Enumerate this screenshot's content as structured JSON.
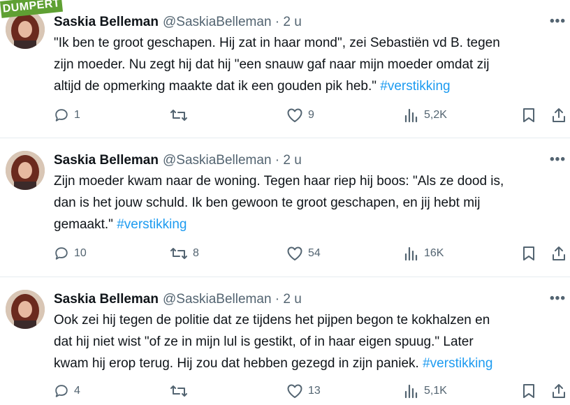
{
  "badge": "DUMPERT",
  "tweets": [
    {
      "name": "Saskia Belleman",
      "handle": "@SaskiaBelleman · 2 u",
      "line1": "\"Ik ben te groot geschapen. Hij zat in haar mond\", zei  Sebastiën vd B. tegen",
      "line2": "zijn moeder. Nu zegt hij dat hij \"een snauw gaf naar mijn moeder omdat zij",
      "line3": "altijd de opmerking maakte dat ik een gouden pik heb.\"",
      "hashtag": "#verstikking",
      "replies": "1",
      "retweets": "",
      "likes": "9",
      "views": "5,2K"
    },
    {
      "name": "Saskia Belleman",
      "handle": "@SaskiaBelleman · 2 u",
      "line1": "Zijn moeder kwam naar de woning. Tegen haar riep hij boos: \"Als ze dood is,",
      "line2": "dan is het jouw schuld. Ik ben gewoon te groot geschapen, en jij hebt mij",
      "line3": "gemaakt.\"",
      "hashtag": "#verstikking",
      "replies": "10",
      "retweets": "8",
      "likes": "54",
      "views": "16K"
    },
    {
      "name": "Saskia Belleman",
      "handle": "@SaskiaBelleman · 2 u",
      "line1": "Ook zei hij tegen de politie dat ze tijdens het pijpen begon te kokhalzen en",
      "line2": "dat hij niet wist \"of ze in mijn lul is gestikt, of in haar eigen spuug.\" Later",
      "line3": "kwam hij erop terug. Hij zou dat hebben gezegd in zijn paniek.",
      "hashtag": "#verstikking",
      "replies": "4",
      "retweets": "",
      "likes": "13",
      "views": "5,1K"
    }
  ],
  "colors": {
    "hashtag": "#1d9bf0",
    "muted": "#536471",
    "badge": "#5fa033"
  },
  "icons": [
    "reply-icon",
    "retweet-icon",
    "like-icon",
    "views-icon",
    "bookmark-icon",
    "share-icon",
    "more-icon"
  ]
}
